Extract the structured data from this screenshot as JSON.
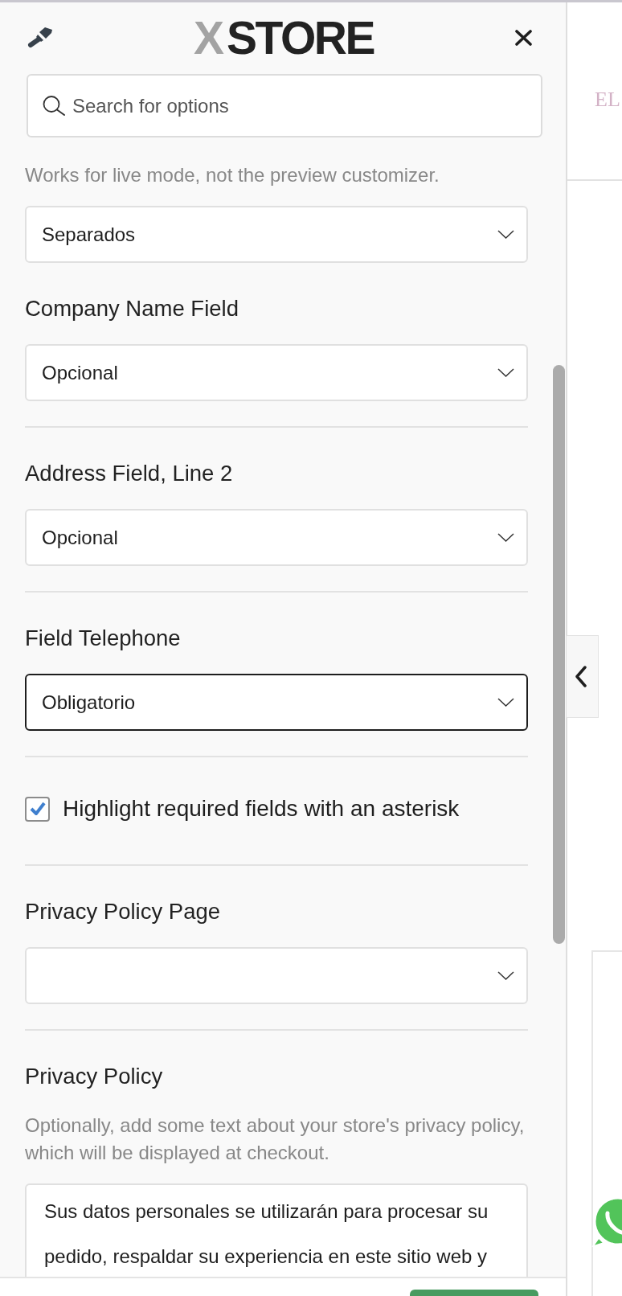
{
  "header": {
    "logo": {
      "mark": "X",
      "name": "STORE"
    }
  },
  "search": {
    "placeholder": "Search for options"
  },
  "options": [
    {
      "kind": "select",
      "description": "Works for live mode, not the preview customizer.",
      "value": "Separados",
      "focused": false
    },
    {
      "kind": "select",
      "label": "Company Name Field",
      "value": "Opcional",
      "focused": false
    },
    {
      "kind": "select",
      "label": "Address Field, Line 2",
      "value": "Opcional",
      "focused": false
    },
    {
      "kind": "select",
      "label": "Field Telephone",
      "value": "Obligatorio",
      "focused": true
    },
    {
      "kind": "checkbox",
      "label": "Highlight required fields with an asterisk",
      "checked": true
    },
    {
      "kind": "select",
      "label": "Privacy Policy Page",
      "focused": false
    },
    {
      "kind": "textarea",
      "label": "Privacy Policy",
      "description": "Optionally, add some text about your store's privacy policy, which will be displayed at checkout.",
      "value": "Sus datos personales se utilizarán para procesar su pedido, respaldar su experiencia en este sitio web y"
    }
  ],
  "preview": {
    "heading": "EL"
  }
}
